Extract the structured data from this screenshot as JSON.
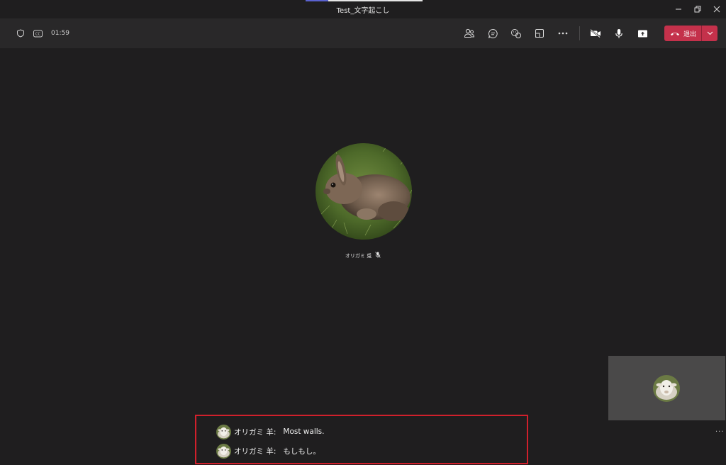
{
  "window": {
    "title": "Test_文字起こし"
  },
  "toolbar": {
    "timer": "01:59",
    "leave_label": "退出"
  },
  "participant": {
    "name": "オリガミ 兎"
  },
  "captions": [
    {
      "speaker": "オリガミ 羊:",
      "text": "Most walls."
    },
    {
      "speaker": "オリガミ 羊:",
      "text": "もしもし。"
    }
  ],
  "self_view": {
    "more_label": "..."
  },
  "colors": {
    "background": "#1f1e1f",
    "toolbar": "#292829",
    "leave": "#c4314b",
    "caption_border": "#d0202c",
    "accent": "#5a62d0"
  }
}
